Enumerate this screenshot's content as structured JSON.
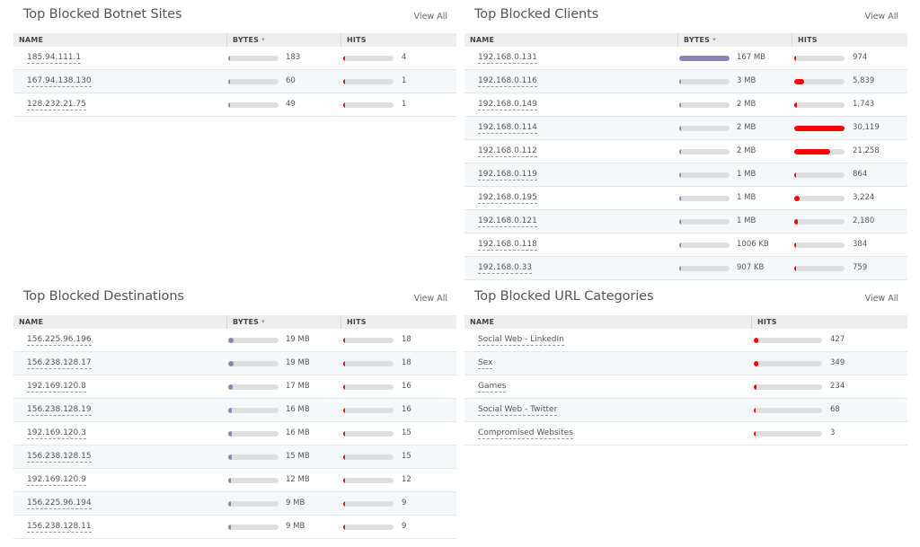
{
  "colors": {
    "bytes_bar": "#8b84b8",
    "hits_bar": "#ff0000",
    "track": "#dedede"
  },
  "view_all_label": "View All",
  "col_name": "NAME",
  "col_bytes": "BYTES",
  "col_hits": "HITS",
  "botnet": {
    "title": "Top Blocked Botnet Sites",
    "rows": [
      {
        "name": "185.94.111.1",
        "bytes": "183",
        "bytes_frac": 0.02,
        "hits": "4",
        "hits_frac": 0.02
      },
      {
        "name": "167.94.138.130",
        "bytes": "60",
        "bytes_frac": 0.01,
        "hits": "1",
        "hits_frac": 0.01
      },
      {
        "name": "128.232.21.75",
        "bytes": "49",
        "bytes_frac": 0.01,
        "hits": "1",
        "hits_frac": 0.01
      }
    ]
  },
  "clients": {
    "title": "Top Blocked Clients",
    "rows": [
      {
        "name": "192.168.0.131",
        "bytes": "167 MB",
        "bytes_frac": 1.0,
        "hits": "974",
        "hits_frac": 0.03
      },
      {
        "name": "192.168.0.116",
        "bytes": "3 MB",
        "bytes_frac": 0.02,
        "hits": "5,839",
        "hits_frac": 0.19
      },
      {
        "name": "192.168.0.149",
        "bytes": "2 MB",
        "bytes_frac": 0.01,
        "hits": "1,743",
        "hits_frac": 0.06
      },
      {
        "name": "192.168.0.114",
        "bytes": "2 MB",
        "bytes_frac": 0.01,
        "hits": "30,119",
        "hits_frac": 1.0
      },
      {
        "name": "192.168.0.112",
        "bytes": "2 MB",
        "bytes_frac": 0.01,
        "hits": "21,258",
        "hits_frac": 0.71
      },
      {
        "name": "192.168.0.119",
        "bytes": "1 MB",
        "bytes_frac": 0.01,
        "hits": "864",
        "hits_frac": 0.03
      },
      {
        "name": "192.168.0.195",
        "bytes": "1 MB",
        "bytes_frac": 0.01,
        "hits": "3,224",
        "hits_frac": 0.11
      },
      {
        "name": "192.168.0.121",
        "bytes": "1 MB",
        "bytes_frac": 0.01,
        "hits": "2,180",
        "hits_frac": 0.07
      },
      {
        "name": "192.168.0.118",
        "bytes": "1006 KB",
        "bytes_frac": 0.01,
        "hits": "384",
        "hits_frac": 0.02
      },
      {
        "name": "192.168.0.33",
        "bytes": "907 KB",
        "bytes_frac": 0.01,
        "hits": "759",
        "hits_frac": 0.03
      }
    ]
  },
  "destinations": {
    "title": "Top Blocked Destinations",
    "rows": [
      {
        "name": "156.225.96.196",
        "bytes": "19 MB",
        "bytes_frac": 0.1,
        "hits": "18",
        "hits_frac": 0.02
      },
      {
        "name": "156.238.128.17",
        "bytes": "19 MB",
        "bytes_frac": 0.1,
        "hits": "18",
        "hits_frac": 0.02
      },
      {
        "name": "192.169.120.8",
        "bytes": "17 MB",
        "bytes_frac": 0.09,
        "hits": "16",
        "hits_frac": 0.02
      },
      {
        "name": "156.238.128.19",
        "bytes": "16 MB",
        "bytes_frac": 0.08,
        "hits": "16",
        "hits_frac": 0.02
      },
      {
        "name": "192.169.120.3",
        "bytes": "16 MB",
        "bytes_frac": 0.08,
        "hits": "15",
        "hits_frac": 0.02
      },
      {
        "name": "156.238.128.15",
        "bytes": "15 MB",
        "bytes_frac": 0.08,
        "hits": "15",
        "hits_frac": 0.02
      },
      {
        "name": "192.169.120.9",
        "bytes": "12 MB",
        "bytes_frac": 0.06,
        "hits": "12",
        "hits_frac": 0.02
      },
      {
        "name": "156.225.96.194",
        "bytes": "9 MB",
        "bytes_frac": 0.05,
        "hits": "9",
        "hits_frac": 0.01
      },
      {
        "name": "156.238.128.11",
        "bytes": "9 MB",
        "bytes_frac": 0.05,
        "hits": "9",
        "hits_frac": 0.01
      }
    ]
  },
  "url_categories": {
    "title": "Top Blocked URL Categories",
    "rows": [
      {
        "name": "Social Web - LinkedIn",
        "hits": "427",
        "hits_frac": 0.07
      },
      {
        "name": "Sex",
        "hits": "349",
        "hits_frac": 0.06
      },
      {
        "name": "Games",
        "hits": "234",
        "hits_frac": 0.04
      },
      {
        "name": "Social Web - Twitter",
        "hits": "68",
        "hits_frac": 0.02
      },
      {
        "name": "Compromised Websites",
        "hits": "3",
        "hits_frac": 0.01
      }
    ]
  }
}
